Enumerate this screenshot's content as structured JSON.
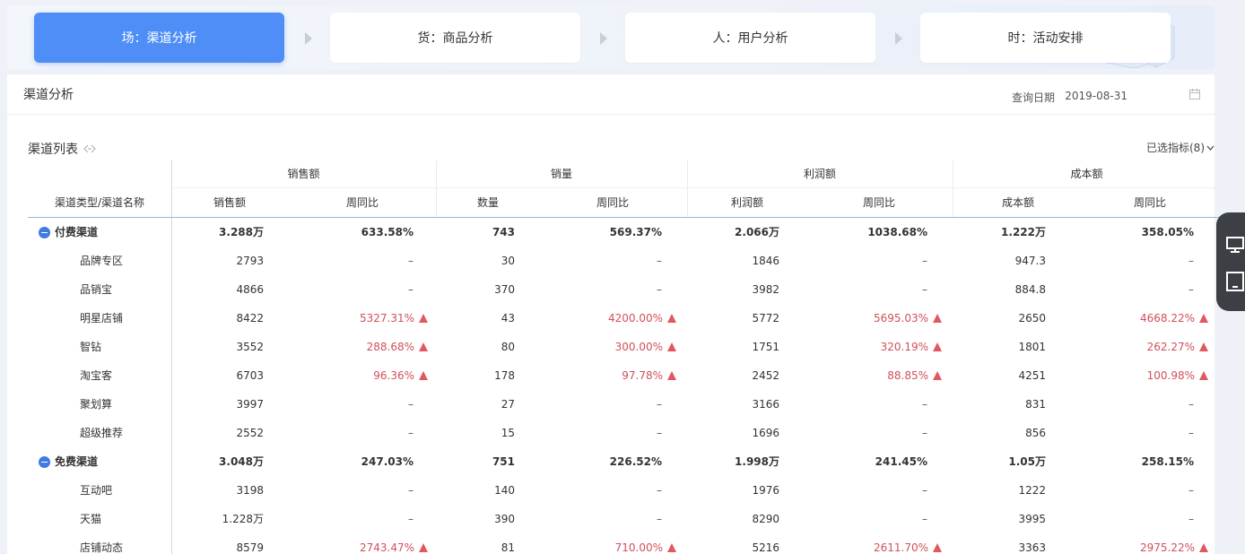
{
  "tabs": [
    {
      "label": "场：渠道分析",
      "active": true
    },
    {
      "label": "货：商品分析",
      "active": false
    },
    {
      "label": "人：用户分析",
      "active": false
    },
    {
      "label": "时：活动安排",
      "active": false
    }
  ],
  "card": {
    "title": "渠道分析",
    "date_label": "查询日期",
    "date_value": "2019-08-31"
  },
  "list": {
    "title": "渠道列表",
    "selected_metrics": "已选指标(8)"
  },
  "table": {
    "name_header": "渠道类型/渠道名称",
    "groups": [
      "销售额",
      "销量",
      "利润额",
      "成本额"
    ],
    "subheaders": [
      "销售额",
      "周同比",
      "数量",
      "周同比",
      "利润额",
      "周同比",
      "成本额",
      "周同比"
    ],
    "rows": [
      {
        "kind": "group",
        "name": "付费渠道",
        "values": [
          "3.288万",
          "633.58%",
          "743",
          "569.37%",
          "2.066万",
          "1038.68%",
          "1.222万",
          "358.05%"
        ],
        "up": [
          false,
          false,
          false,
          false
        ]
      },
      {
        "kind": "child",
        "name": "品牌专区",
        "values": [
          "2793",
          "–",
          "30",
          "–",
          "1846",
          "–",
          "947.3",
          "–"
        ],
        "up": [
          false,
          false,
          false,
          false
        ]
      },
      {
        "kind": "child",
        "name": "品销宝",
        "values": [
          "4866",
          "–",
          "370",
          "–",
          "3982",
          "–",
          "884.8",
          "–"
        ],
        "up": [
          false,
          false,
          false,
          false
        ]
      },
      {
        "kind": "child",
        "name": "明星店铺",
        "values": [
          "8422",
          "5327.31%",
          "43",
          "4200.00%",
          "5772",
          "5695.03%",
          "2650",
          "4668.22%"
        ],
        "up": [
          true,
          true,
          true,
          true
        ]
      },
      {
        "kind": "child",
        "name": "智钻",
        "values": [
          "3552",
          "288.68%",
          "80",
          "300.00%",
          "1751",
          "320.19%",
          "1801",
          "262.27%"
        ],
        "up": [
          true,
          true,
          true,
          true
        ]
      },
      {
        "kind": "child",
        "name": "淘宝客",
        "values": [
          "6703",
          "96.36%",
          "178",
          "97.78%",
          "2452",
          "88.85%",
          "4251",
          "100.98%"
        ],
        "up": [
          true,
          true,
          true,
          true
        ]
      },
      {
        "kind": "child",
        "name": "聚划算",
        "values": [
          "3997",
          "–",
          "27",
          "–",
          "3166",
          "–",
          "831",
          "–"
        ],
        "up": [
          false,
          false,
          false,
          false
        ]
      },
      {
        "kind": "child",
        "name": "超级推荐",
        "values": [
          "2552",
          "–",
          "15",
          "–",
          "1696",
          "–",
          "856",
          "–"
        ],
        "up": [
          false,
          false,
          false,
          false
        ]
      },
      {
        "kind": "group",
        "name": "免费渠道",
        "values": [
          "3.048万",
          "247.03%",
          "751",
          "226.52%",
          "1.998万",
          "241.45%",
          "1.05万",
          "258.15%"
        ],
        "up": [
          false,
          false,
          false,
          false
        ]
      },
      {
        "kind": "child",
        "name": "互动吧",
        "values": [
          "3198",
          "–",
          "140",
          "–",
          "1976",
          "–",
          "1222",
          "–"
        ],
        "up": [
          false,
          false,
          false,
          false
        ]
      },
      {
        "kind": "child",
        "name": "天猫",
        "values": [
          "1.228万",
          "–",
          "390",
          "–",
          "8290",
          "–",
          "3995",
          "–"
        ],
        "up": [
          false,
          false,
          false,
          false
        ]
      },
      {
        "kind": "child",
        "name": "店铺动态",
        "values": [
          "8579",
          "2743.47%",
          "81",
          "710.00%",
          "5216",
          "2611.70%",
          "3363",
          "2975.22%"
        ],
        "up": [
          true,
          true,
          true,
          true
        ]
      }
    ]
  },
  "colors": {
    "active_tab": "#4f8ef7",
    "up_text": "#d1505a",
    "up_arrow": "#e0595f",
    "collapse_icon": "#3f7be0"
  },
  "icons": {
    "calendar": "calendar-icon",
    "link": "link-icon",
    "dropdown": "chevron-down-icon",
    "collapse": "minus-circle-icon",
    "trend_up": "triangle-up-icon",
    "side_widget": [
      "monitor-icon",
      "tablet-icon"
    ]
  }
}
